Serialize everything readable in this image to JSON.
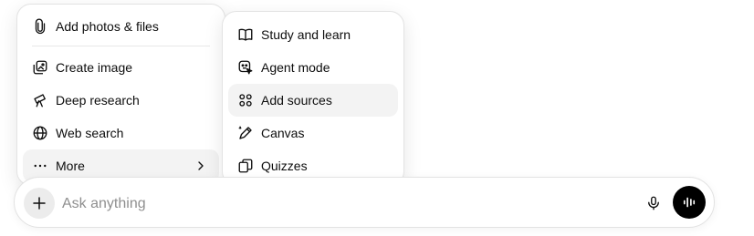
{
  "composer": {
    "placeholder": "Ask anything",
    "icons": {
      "plus": "plus-icon",
      "mic": "microphone-icon",
      "voice": "voice-waveform-icon"
    }
  },
  "main_menu": {
    "items": [
      {
        "label": "Add photos & files",
        "icon": "paperclip-icon"
      },
      {
        "label": "Create image",
        "icon": "image-icon"
      },
      {
        "label": "Deep research",
        "icon": "telescope-icon"
      },
      {
        "label": "Web search",
        "icon": "globe-icon"
      },
      {
        "label": "More",
        "icon": "ellipsis-icon",
        "submenu_icon": "chevron-right-icon"
      }
    ]
  },
  "sub_menu": {
    "items": [
      {
        "label": "Study and learn",
        "icon": "book-icon"
      },
      {
        "label": "Agent mode",
        "icon": "agent-icon"
      },
      {
        "label": "Add sources",
        "icon": "sources-icon",
        "hovered": true
      },
      {
        "label": "Canvas",
        "icon": "pen-icon"
      },
      {
        "label": "Quizzes",
        "icon": "cards-icon"
      }
    ]
  },
  "colors": {
    "voice_button": "#000000",
    "hover": "#f3f3f3",
    "plus_button": "#ececec"
  }
}
